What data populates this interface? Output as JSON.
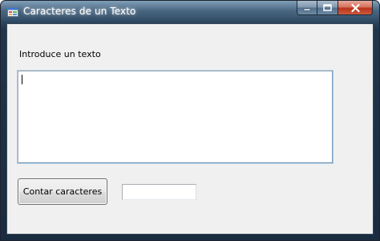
{
  "window": {
    "title": "Caracteres de un Texto",
    "app_icon": "form-app-icon",
    "caption_buttons": [
      "minimize-icon",
      "maximize-icon",
      "close-icon"
    ]
  },
  "form": {
    "prompt_label": "Introduce un texto",
    "text_input_value": "",
    "count_button_label": "Contar caracteres",
    "result_value": ""
  },
  "colors": {
    "client_background": "#f0f0f0",
    "close_button": "#c7432a",
    "titlebar": "#2f4a63"
  }
}
